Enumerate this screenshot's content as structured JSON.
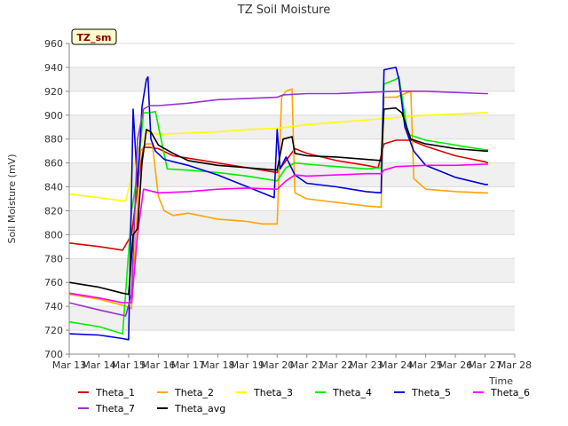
{
  "chart_data": {
    "type": "line",
    "title": "TZ Soil Moisture",
    "badge": "TZ_sm",
    "xlabel": "Time",
    "ylabel": "Soil Moisture (mV)",
    "xlim": [
      13,
      28
    ],
    "ylim": [
      700,
      960
    ],
    "x_ticks": [
      13,
      14,
      15,
      16,
      17,
      18,
      19,
      20,
      21,
      22,
      23,
      24,
      25,
      26,
      27,
      28
    ],
    "x_tick_labels": [
      "Mar 13",
      "Mar 14",
      "Mar 15",
      "Mar 16",
      "Mar 17",
      "Mar 18",
      "Mar 19",
      "Mar 20",
      "Mar 21",
      "Mar 22",
      "Mar 23",
      "Mar 24",
      "Mar 25",
      "Mar 26",
      "Mar 27",
      "Mar 28"
    ],
    "y_ticks": [
      700,
      720,
      740,
      760,
      780,
      800,
      820,
      840,
      860,
      880,
      900,
      920,
      940,
      960
    ],
    "y_tick_labels": [
      "700",
      "720",
      "740",
      "760",
      "780",
      "800",
      "820",
      "840",
      "860",
      "880",
      "900",
      "920",
      "940",
      "960"
    ],
    "grid": true,
    "legend_position": "bottom",
    "series": [
      {
        "name": "Theta_1",
        "color": "#dd0000",
        "x": [
          13,
          14,
          14.8,
          15.1,
          15.3,
          15.5,
          15.7,
          16,
          16.5,
          17,
          18,
          19,
          20,
          20.3,
          20.6,
          21,
          22,
          23,
          23.4,
          23.6,
          24,
          24.5,
          25,
          26,
          27,
          27.1
        ],
        "y": [
          793,
          790,
          787,
          800,
          840,
          873,
          873,
          872,
          866,
          864,
          860,
          856,
          852,
          862,
          872,
          868,
          862,
          858,
          856,
          876,
          879,
          879,
          874,
          866,
          861,
          860
        ]
      },
      {
        "name": "Theta_2",
        "color": "#ffa500",
        "x": [
          13,
          14,
          14.8,
          15.1,
          15.4,
          15.6,
          15.8,
          16,
          16.2,
          16.5,
          17,
          18,
          19,
          19.5,
          20,
          20.15,
          20.3,
          20.5,
          20.6,
          21,
          22,
          23,
          23.5,
          23.6,
          24,
          24.5,
          24.6,
          25,
          26,
          27,
          27.1
        ],
        "y": [
          750,
          746,
          741,
          738,
          870,
          876,
          876,
          832,
          820,
          816,
          818,
          813,
          811,
          809,
          809,
          915,
          920,
          922,
          835,
          830,
          827,
          824,
          823,
          915,
          915,
          920,
          847,
          838,
          836,
          835,
          835
        ]
      },
      {
        "name": "Theta_3",
        "color": "#ffff00",
        "x": [
          13,
          14,
          14.9,
          15.3,
          15.6,
          16,
          17,
          18,
          19,
          20,
          21,
          22,
          23,
          24,
          25,
          26,
          27,
          27.1
        ],
        "y": [
          834,
          831,
          828,
          870,
          886,
          884,
          885,
          886,
          888,
          889,
          892,
          894,
          896,
          898,
          900,
          901,
          902,
          902
        ]
      },
      {
        "name": "Theta_4",
        "color": "#00ee00",
        "x": [
          13,
          14,
          14.8,
          15.1,
          15.3,
          15.5,
          15.7,
          15.9,
          16.3,
          17,
          18,
          19,
          20,
          20.3,
          20.6,
          21,
          22,
          23,
          23.5,
          23.6,
          24,
          24.1,
          24.4,
          25,
          26,
          27,
          27.1
        ],
        "y": [
          727,
          723,
          717,
          820,
          852,
          902,
          902,
          903,
          855,
          854,
          852,
          849,
          845,
          856,
          860,
          859,
          857,
          855,
          856,
          926,
          930,
          932,
          884,
          879,
          875,
          871,
          871
        ]
      },
      {
        "name": "Theta_5",
        "color": "#0000dd",
        "x": [
          13,
          14,
          14.8,
          15.0,
          15.15,
          15.3,
          15.45,
          15.6,
          15.65,
          15.75,
          15.9,
          16.2,
          17,
          18,
          19,
          19.9,
          20.0,
          20.1,
          20.3,
          20.6,
          21,
          22,
          23,
          23.5,
          23.6,
          24,
          24.1,
          24.3,
          24.6,
          25,
          26,
          27,
          27.1
        ],
        "y": [
          717,
          716,
          713,
          712,
          905,
          840,
          907,
          930,
          932,
          880,
          870,
          863,
          858,
          850,
          840,
          831,
          888,
          855,
          865,
          850,
          843,
          840,
          836,
          835,
          938,
          940,
          930,
          890,
          870,
          858,
          848,
          842,
          842
        ]
      },
      {
        "name": "Theta_6",
        "color": "#ff00ff",
        "x": [
          13,
          14,
          14.8,
          15.1,
          15.3,
          15.5,
          16,
          17,
          18,
          19,
          20,
          20.3,
          20.6,
          21,
          22,
          23,
          23.5,
          23.6,
          24,
          25,
          26,
          27,
          27.1
        ],
        "y": [
          751,
          747,
          743,
          743,
          800,
          838,
          835,
          836,
          838,
          839,
          838,
          845,
          850,
          849,
          850,
          851,
          851,
          854,
          857,
          858,
          858,
          859,
          859
        ]
      },
      {
        "name": "Theta_7",
        "color": "#9932cc",
        "x": [
          13,
          14,
          14.9,
          15.1,
          15.3,
          15.5,
          15.7,
          16,
          17,
          18,
          19,
          20,
          20.2,
          21,
          22,
          23,
          24,
          25,
          26,
          27,
          27.1
        ],
        "y": [
          743,
          737,
          732,
          750,
          880,
          905,
          908,
          908,
          910,
          913,
          914,
          915,
          917,
          918,
          918,
          919,
          920,
          920,
          919,
          918,
          918
        ]
      },
      {
        "name": "Theta_avg",
        "color": "#000000",
        "x": [
          13,
          14,
          14.8,
          15.0,
          15.15,
          15.3,
          15.45,
          15.6,
          15.75,
          16,
          16.5,
          17,
          18,
          19,
          20,
          20.2,
          20.5,
          20.6,
          21,
          22,
          23,
          23.5,
          23.6,
          24,
          24.2,
          24.5,
          25,
          26,
          27,
          27.1
        ],
        "y": [
          760,
          756,
          751,
          750,
          800,
          805,
          860,
          888,
          886,
          875,
          868,
          862,
          858,
          856,
          854,
          880,
          882,
          868,
          866,
          865,
          863,
          862,
          905,
          906,
          902,
          880,
          876,
          872,
          870,
          870
        ]
      }
    ]
  }
}
